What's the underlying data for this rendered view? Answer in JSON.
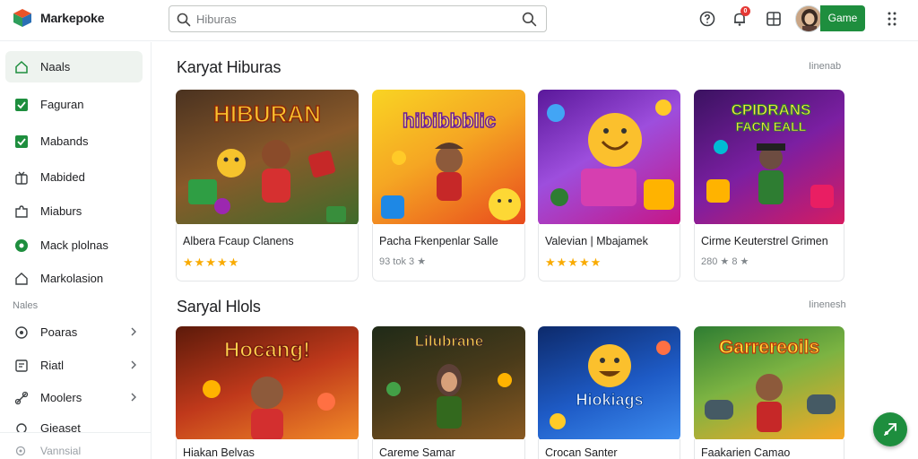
{
  "app": {
    "brand": "Markepoke",
    "search_placeholder": "Hiburas",
    "notification_count": "0",
    "game_button": "Game"
  },
  "sidebar": {
    "items": [
      {
        "label": "Naals",
        "icon": "home-icon",
        "active": true
      },
      {
        "label": "Faguran",
        "icon": "checkbox-icon"
      },
      {
        "label": "Mabands",
        "icon": "checkbox-icon"
      },
      {
        "label": "Mabided",
        "icon": "gift-icon"
      },
      {
        "label": "Miaburs",
        "icon": "puzzle-icon"
      },
      {
        "label": "Mack plolnas",
        "icon": "circle-icon"
      },
      {
        "label": "Markolasion",
        "icon": "home-outline-icon"
      }
    ],
    "section_label": "Nales",
    "sub_items": [
      {
        "label": "Poaras",
        "icon": "location-icon"
      },
      {
        "label": "Riatl",
        "icon": "flag-icon"
      },
      {
        "label": "Moolers",
        "icon": "link-icon"
      },
      {
        "label": "Gieaset",
        "icon": "settings-icon"
      }
    ],
    "bottom_label": "Vannsial"
  },
  "sections": [
    {
      "title": "Karyat Hiburas",
      "more": "Iinenab",
      "cards": [
        {
          "title": "Albera Fcaup Clanens",
          "image_text": "HIBURAN",
          "rating_stars": "★★★★★",
          "meta": "",
          "colors": [
            "#6d4c2f",
            "#c97d2a"
          ]
        },
        {
          "title": "Pacha Fkenpenlar Salle",
          "image_text": "hibibbblic",
          "rating_stars": "",
          "meta": "93 tok 3 ★",
          "colors": [
            "#f5a623",
            "#e8491d"
          ]
        },
        {
          "title": "Valevian | Mbajamek",
          "image_text": "",
          "rating_stars": "★★★★★",
          "meta": "",
          "colors": [
            "#7b2cbf",
            "#c71585"
          ]
        },
        {
          "title": "Cirme Keuterstrel Grimen",
          "image_text": "CPIDRANS FACN EALL",
          "rating_stars": "",
          "meta": "280 ★ 8 ★",
          "colors": [
            "#4a1a6b",
            "#d81b60"
          ]
        }
      ]
    },
    {
      "title": "Saryal Hlols",
      "more": "Iinenesh",
      "cards": [
        {
          "title": "Hiakan Belvas",
          "image_text": "Hocang!",
          "colors": [
            "#7a1f0f",
            "#e05a1c"
          ]
        },
        {
          "title": "Careme Samar",
          "image_text": "Lilubrane",
          "colors": [
            "#2b3a1f",
            "#6b4a1c"
          ]
        },
        {
          "title": "Crocan Santer",
          "image_text": "Hiokiags",
          "colors": [
            "#123a8c",
            "#2b6fd6"
          ]
        },
        {
          "title": "Faakarien Camao",
          "image_text": "Garrereoils",
          "colors": [
            "#3c8b3a",
            "#f0a030"
          ]
        }
      ]
    }
  ]
}
